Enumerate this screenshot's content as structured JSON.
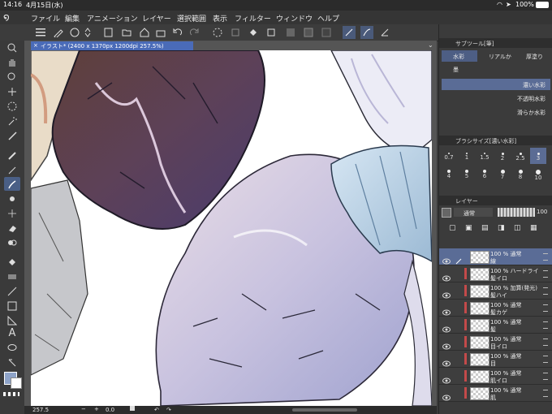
{
  "status": {
    "time": "14:16",
    "date": "4月15日(水)",
    "battery": "100%"
  },
  "menu": {
    "items": [
      "ファイル",
      "編集",
      "アニメーション",
      "レイヤー",
      "選択範囲",
      "表示",
      "フィルター",
      "ウィンドウ",
      "ヘルプ"
    ]
  },
  "canvas": {
    "tab_title": "イラスト* (2400 x 1370px 1200dpi 257.5%)",
    "zoom": "257.5",
    "rotation": "0.0"
  },
  "subtool": {
    "header": "サブツール[筆]",
    "tabs": [
      "水彩",
      "リアルか",
      "厚塗り",
      "墨"
    ],
    "brushes": [
      "濃い水彩",
      "不透明水彩",
      "滑らか水彩"
    ]
  },
  "brushsize": {
    "header": "ブラシサイズ[濃い水彩]",
    "sizes": [
      "0.7",
      "1",
      "1.5",
      "2",
      "2.5",
      "3",
      "4",
      "5",
      "6",
      "7",
      "8",
      "10"
    ]
  },
  "layers": {
    "header": "レイヤー",
    "blend": "通常",
    "opacity": "100",
    "rows": [
      {
        "l1": "100 % 通常",
        "l2": "線"
      },
      {
        "l1": "100 % ハードライ",
        "l2": "髪イロ"
      },
      {
        "l1": "100 % 加算(発光)",
        "l2": "髪ハイ"
      },
      {
        "l1": "100 % 通常",
        "l2": "髪カゲ"
      },
      {
        "l1": "100 % 通常",
        "l2": "髪"
      },
      {
        "l1": "100 % 通常",
        "l2": "目イロ"
      },
      {
        "l1": "100 % 通常",
        "l2": "目"
      },
      {
        "l1": "100 % 通常",
        "l2": "肌イロ"
      },
      {
        "l1": "100 % 通常",
        "l2": "肌"
      }
    ]
  },
  "colors": {
    "accent": "#4a6bb8",
    "selection": "#5a6c96",
    "panel": "#3b3b3b"
  }
}
